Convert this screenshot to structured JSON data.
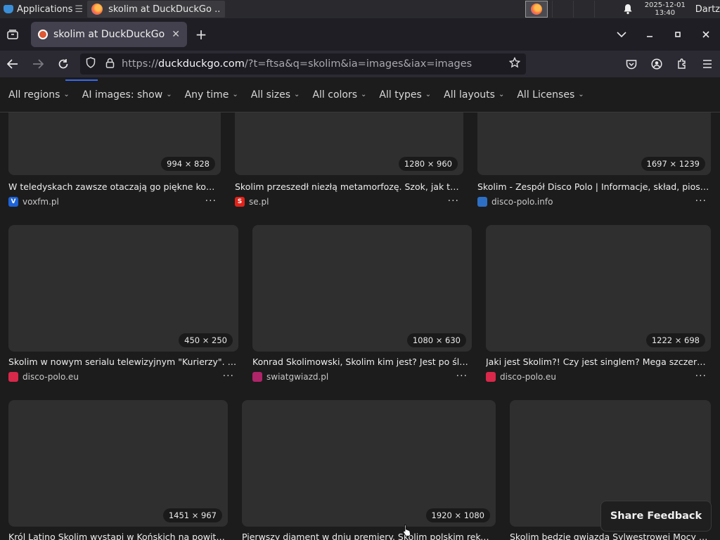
{
  "taskbar": {
    "apps_label": "Applications",
    "task_title": "skolim at DuckDuckGo ...",
    "clock_date": "2025-12-01",
    "clock_time": "13:40",
    "user": "Dartz"
  },
  "browser": {
    "tab_title": "skolim at DuckDuckGo",
    "url_prefix": "https://",
    "url_host": "duckduckgo.com",
    "url_path": "/?t=ftsa&q=skolim&ia=images&iax=images"
  },
  "filters": [
    "All regions",
    "AI images: show",
    "Any time",
    "All sizes",
    "All colors",
    "All types",
    "All layouts",
    "All Licenses"
  ],
  "results": [
    {
      "dims": "994 × 828",
      "title": "W teledyskach zawsze otaczają go piękne kobiety...",
      "source": "voxfm.pl",
      "icon_text": "V",
      "icon_color": "#1e63d8"
    },
    {
      "dims": "1280 × 960",
      "title": "Skolim przeszedł niezłą metamorfozę. Szok, jak teraz ...",
      "source": "se.pl",
      "icon_text": "S",
      "icon_color": "#e2231a"
    },
    {
      "dims": "1697 × 1239",
      "title": "Skolim - Zespół Disco Polo | Informacje, skład, piosenki...",
      "source": "disco-polo.info",
      "icon_text": "",
      "icon_color": "#2d6fc4"
    },
    {
      "dims": "450 × 250",
      "title": "Skolim w nowym serialu telewizyjnym \"Kurierzy\". Wiem...",
      "source": "disco-polo.eu",
      "icon_text": "",
      "icon_color": "#d9284a"
    },
    {
      "dims": "1080 × 630",
      "title": "Konrad Skolimowski, Skolim kim jest? Jest po ślubie...",
      "source": "swiatgwiazd.pl",
      "icon_text": "",
      "icon_color": "#b0246a"
    },
    {
      "dims": "1222 × 698",
      "title": "Jaki jest Skolim?! Czy jest singlem? Mega szczery wy...",
      "source": "disco-polo.eu",
      "icon_text": "",
      "icon_color": "#d9284a"
    },
    {
      "dims": "1451 × 967",
      "title": "Król Latino Skolim wystąpi w Końskich na powitaniu ...",
      "source": "",
      "icon_text": "",
      "icon_color": ""
    },
    {
      "dims": "1920 × 1080",
      "title": "Pierwszy diament w dniu premiery. Skolim polskim rekordzist...",
      "source": "",
      "icon_text": "",
      "icon_color": ""
    },
    {
      "dims": "",
      "title": "Skolim będzie gwiazdą Sylwestrowej Mocy Prze...",
      "source": "",
      "icon_text": "",
      "icon_color": ""
    }
  ],
  "feedback_label": "Share Feedback"
}
